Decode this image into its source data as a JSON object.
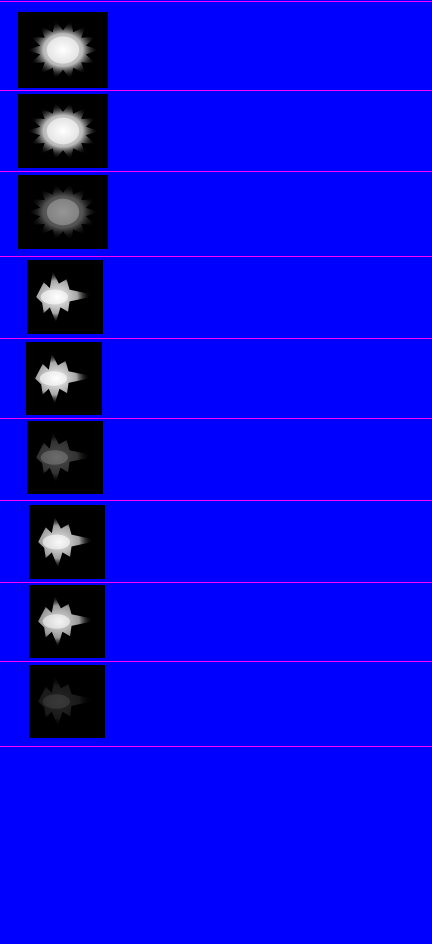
{
  "sheet": {
    "background_color": "#0000ff",
    "divider_color": "#ff00ff",
    "frame_background": "#000000"
  },
  "frames": [
    {
      "icon": "starburst-explosion-icon",
      "brightness": 1.0
    },
    {
      "icon": "starburst-explosion-icon",
      "brightness": 1.0
    },
    {
      "icon": "starburst-explosion-icon",
      "brightness": 0.45
    },
    {
      "icon": "directional-blast-icon",
      "brightness": 1.0
    },
    {
      "icon": "directional-blast-icon",
      "brightness": 1.0
    },
    {
      "icon": "directional-blast-icon",
      "brightness": 0.3
    },
    {
      "icon": "directional-blast-icon",
      "brightness": 0.95
    },
    {
      "icon": "directional-blast-icon",
      "brightness": 0.9
    },
    {
      "icon": "directional-blast-icon",
      "brightness": 0.15
    }
  ]
}
